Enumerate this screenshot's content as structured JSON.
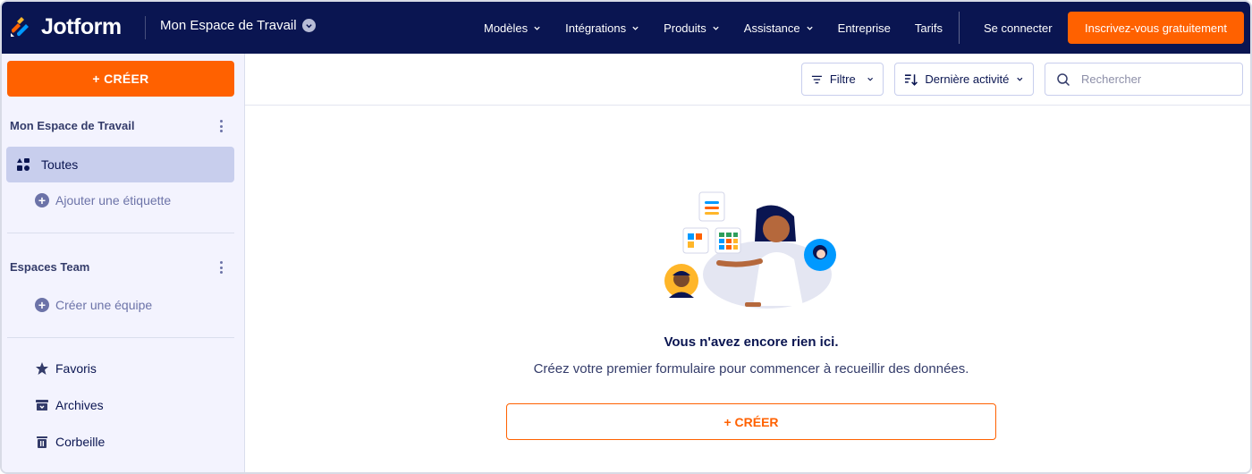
{
  "brand": {
    "name": "Jotform",
    "accent": "#ff6100",
    "navy": "#0a1551"
  },
  "header": {
    "workspace_title": "Mon Espace de Travail",
    "nav": [
      {
        "label": "Modèles",
        "has_dropdown": true
      },
      {
        "label": "Intégrations",
        "has_dropdown": true
      },
      {
        "label": "Produits",
        "has_dropdown": true
      },
      {
        "label": "Assistance",
        "has_dropdown": true
      },
      {
        "label": "Entreprise",
        "has_dropdown": false
      },
      {
        "label": "Tarifs",
        "has_dropdown": false
      }
    ],
    "login_label": "Se connecter",
    "signup_label": "Inscrivez-vous gratuitement"
  },
  "sidebar": {
    "create_label": "+ CRÉER",
    "workspace_section": "Mon Espace de Travail",
    "all_label": "Toutes",
    "add_tag_label": "Ajouter une étiquette",
    "teams_section": "Espaces Team",
    "create_team_label": "Créer une équipe",
    "favorites_label": "Favoris",
    "archives_label": "Archives",
    "trash_label": "Corbeille"
  },
  "toolbar": {
    "filter_label": "Filtre",
    "sort_label": "Dernière activité",
    "search_placeholder": "Rechercher"
  },
  "empty_state": {
    "title": "Vous n'avez encore rien ici.",
    "description": "Créez votre premier formulaire pour commencer à recueillir des données.",
    "create_label": "+ CRÉER"
  }
}
